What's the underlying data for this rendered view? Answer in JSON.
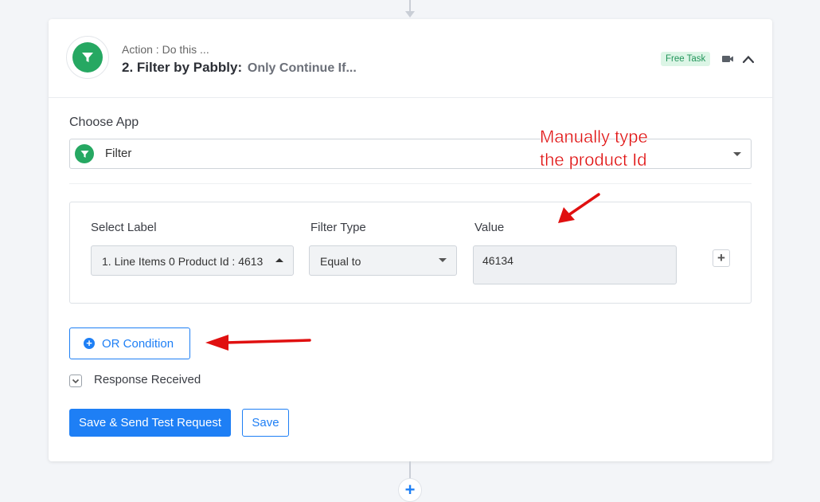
{
  "step": {
    "subtitle": "Action : Do this ...",
    "title": "2. Filter by Pabbly:",
    "description": "Only Continue If...",
    "badge": "Free Task",
    "badge_color": "#22955a",
    "icons": [
      "video-icon",
      "chevron-up-icon"
    ]
  },
  "choose_app": {
    "label": "Choose App",
    "value": "Filter",
    "icon": "filter-icon"
  },
  "filter": {
    "columns": {
      "select_label": "Select Label",
      "filter_type": "Filter Type",
      "value": "Value"
    },
    "select_label_value": "1. Line Items 0 Product Id : 4613",
    "filter_type_value": "Equal to",
    "value": "46134"
  },
  "or_condition_label": "OR Condition",
  "response_received_label": "Response Received",
  "buttons": {
    "save_send": "Save & Send Test Request",
    "save": "Save"
  },
  "annotation": {
    "line1": "Manually type",
    "line2": "the product Id",
    "color": "#e01010"
  },
  "colors": {
    "accent": "#1e7ff5",
    "brand_green": "#26a862"
  }
}
